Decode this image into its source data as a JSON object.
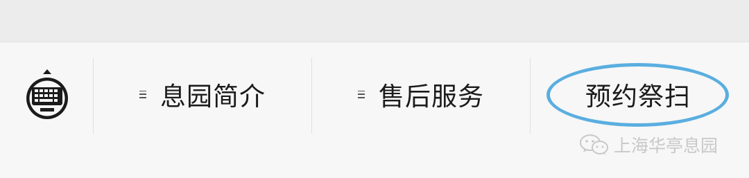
{
  "menu": {
    "items": [
      {
        "label": "息园简介",
        "icon": "menu-lines-icon"
      },
      {
        "label": "售后服务",
        "icon": "menu-lines-icon"
      },
      {
        "label": "预约祭扫",
        "icon": "none"
      }
    ]
  },
  "keyboard_toggle": {
    "icon": "keyboard-icon"
  },
  "watermark": {
    "text": "上海华亭息园",
    "icon": "wechat-icon"
  },
  "colors": {
    "highlight": "#5aaee0",
    "text": "#1b1b1b",
    "background": "#f7f7f7",
    "top_strip": "#ececec"
  }
}
